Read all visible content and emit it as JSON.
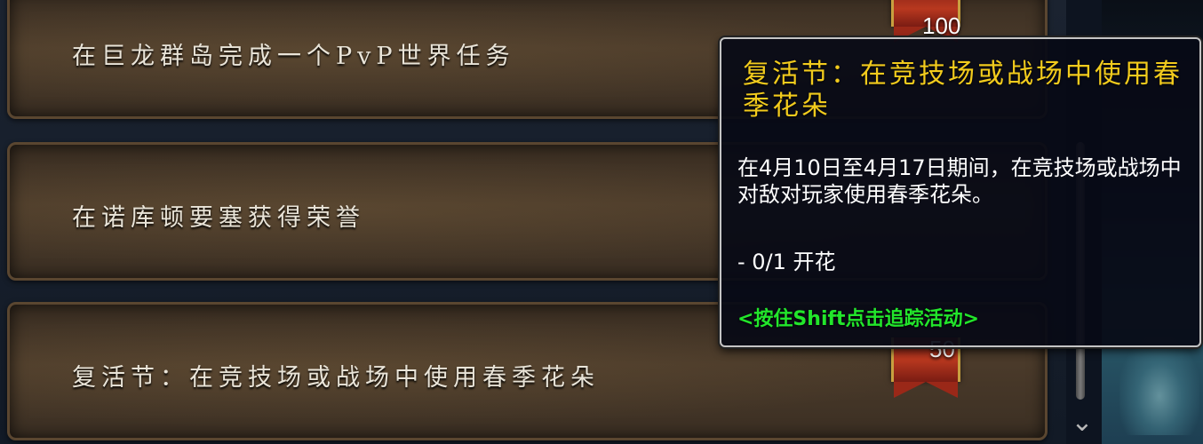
{
  "activities": [
    {
      "name": "在巨龙群岛完成一个PvP世界任务",
      "points": "100"
    },
    {
      "name": "在诺库顿要塞获得荣誉",
      "points": ""
    },
    {
      "name": "复活节：在竞技场或战场中使用春季花朵",
      "points": "50"
    }
  ],
  "tooltip": {
    "title": "复活节：在竞技场或战场中使用春季花朵",
    "description": "在4月10日至4月17日期间，在竞技场或战场中对敌对玩家使用春季花朵。",
    "progress": "- 0/1 开花",
    "hint": "<按住Shift点击追踪活动>"
  },
  "colors": {
    "tooltip_title": "#f2cb1d",
    "tooltip_hint": "#22e62b",
    "banner": "#b8381f"
  },
  "icons": {
    "scroll_down": "chevron-down-icon"
  }
}
